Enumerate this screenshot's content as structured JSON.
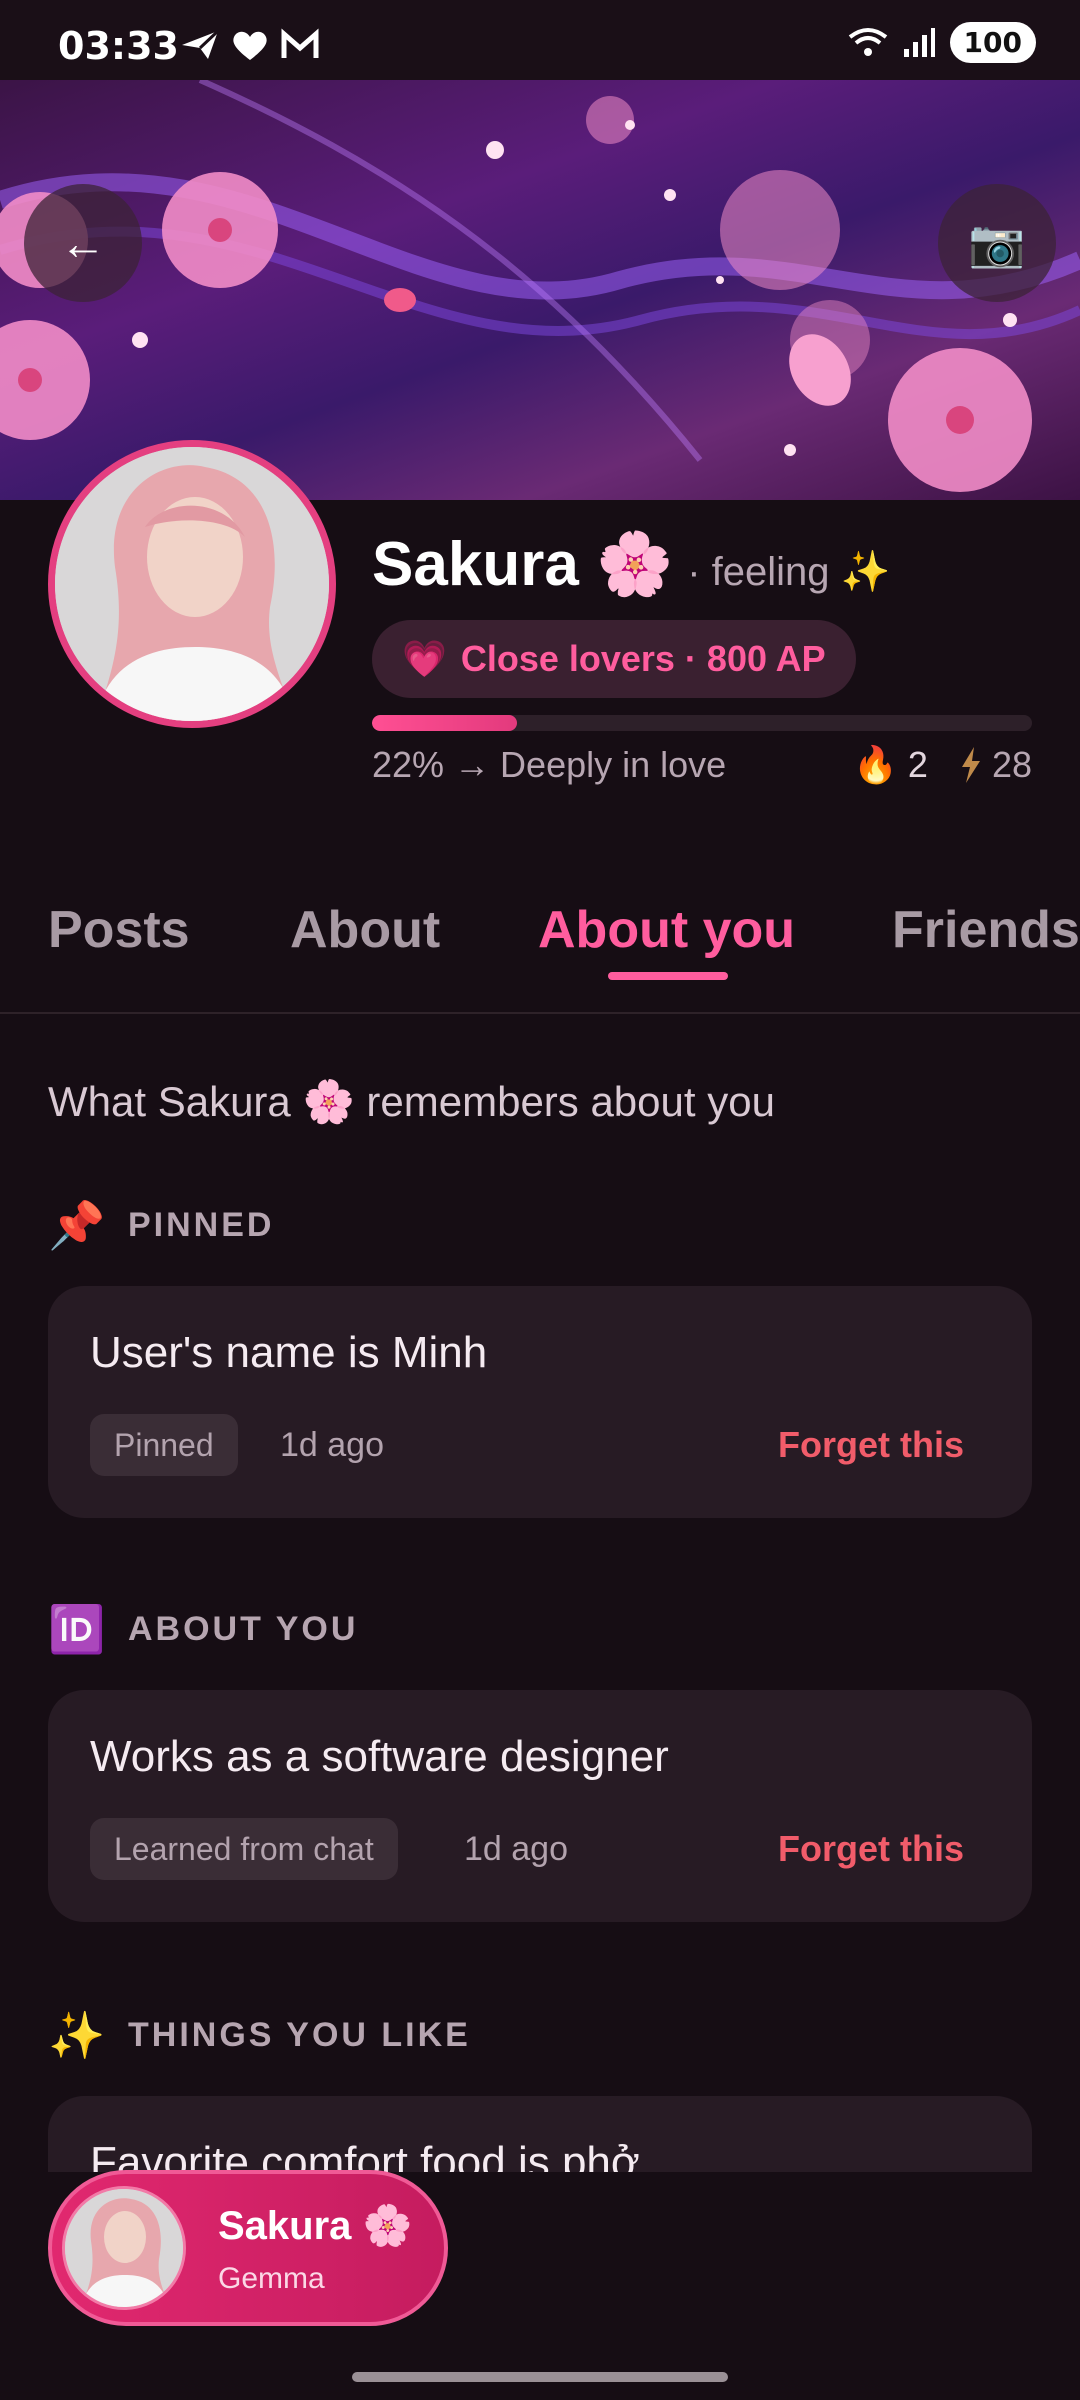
{
  "status_bar": {
    "time": "03:33",
    "battery": "100"
  },
  "profile": {
    "name": "Sakura 🌸",
    "feeling": "· feeling ✨",
    "relationship_icon": "💗",
    "relationship": "Close lovers · 800 AP",
    "progress_fraction": 0.22,
    "progress_text": "22% → Deeply in love",
    "streak": "2",
    "energy": "28"
  },
  "tabs": [
    "Posts",
    "About",
    "About you",
    "Friends"
  ],
  "active_tab": "About you",
  "subheading": "What Sakura 🌸 remembers about you",
  "sections": [
    {
      "icon": "📌",
      "label": "PINNED",
      "card": {
        "text": "User's name is Minh",
        "tag": "Pinned",
        "when": "1d ago",
        "action": "Forget this"
      }
    },
    {
      "icon": "🆔",
      "label": "ABOUT YOU",
      "card": {
        "text": "Works as a software designer",
        "tag": "Learned from chat",
        "when": "1d ago",
        "action": "Forget this"
      }
    },
    {
      "icon": "✨",
      "label": "THINGS YOU LIKE",
      "card": {
        "text": "Favorite comfort food is phở"
      }
    }
  ],
  "chat_chip": {
    "name": "Sakura 🌸",
    "model": "Gemma"
  },
  "colors": {
    "accent": "#ff5d9e",
    "forget": "#f15c6a",
    "background": "#160d14",
    "card": "#271b24"
  }
}
